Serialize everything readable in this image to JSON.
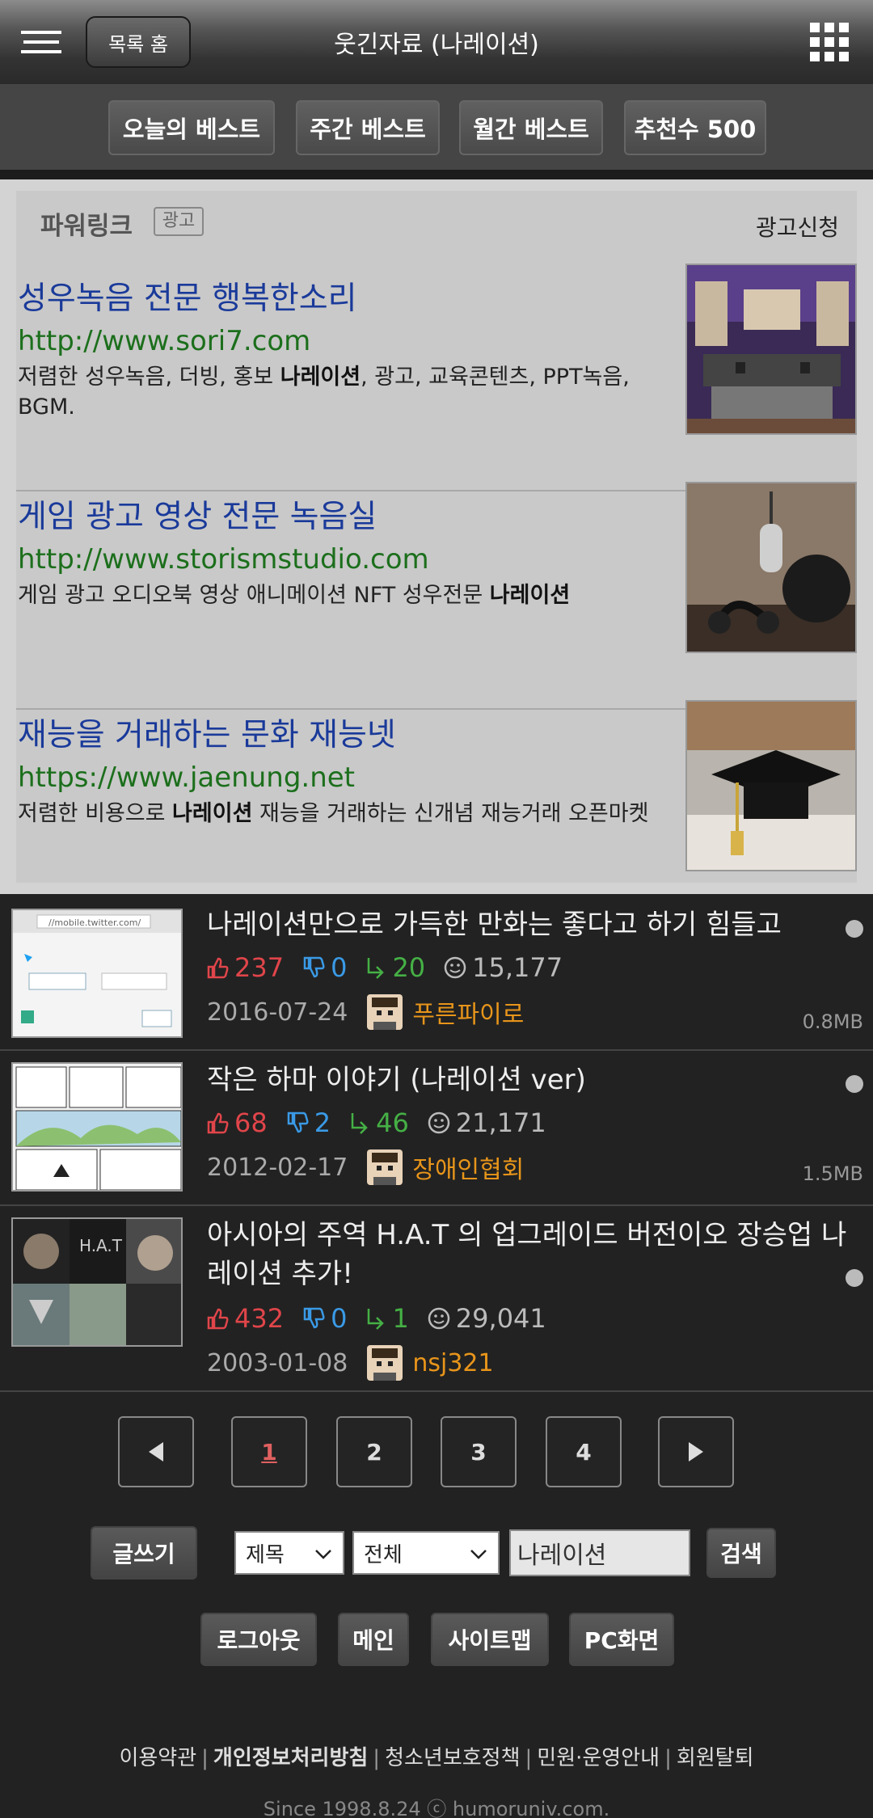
{
  "header": {
    "home_label": "목록 홈",
    "title": "웃긴자료 (나레이션)",
    "menu_icon": "menu-icon",
    "apps_icon": "grid-icon"
  },
  "tabs": [
    {
      "label": "오늘의 베스트"
    },
    {
      "label": "주간 베스트"
    },
    {
      "label": "월간 베스트"
    },
    {
      "label": "추천수 500"
    }
  ],
  "ads": {
    "logo": "파워링크",
    "badge": "광고",
    "apply": "광고신청",
    "items": [
      {
        "title": "성우녹음 전문 행복한소리",
        "url": "http://www.sori7.com",
        "desc_pre": "저렴한 성우녹음, 더빙, 홍보 ",
        "desc_bold": "나레이션",
        "desc_post": ", 광고, 교육콘텐츠, PPT녹음, BGM."
      },
      {
        "title": "게임 광고 영상 전문 녹음실",
        "url": "http://www.storismstudio.com",
        "desc_pre": "게임 광고 오디오북 영상 애니메이션 NFT 성우전문 ",
        "desc_bold": "나레이션",
        "desc_post": ""
      },
      {
        "title": "재능을 거래하는 문화 재능넷",
        "url": "https://www.jaenung.net",
        "desc_pre": "저렴한 비용으로 ",
        "desc_bold": "나레이션",
        "desc_post": " 재능을 거래하는 신개념 재능거래 오픈마켓"
      }
    ]
  },
  "posts": [
    {
      "title": "나레이션만으로 가득한 만화는 좋다고 하기 힘들고",
      "up": "237",
      "down": "0",
      "share": "20",
      "views": "15,177",
      "date": "2016-07-24",
      "author": "푸른파이로",
      "size": "0.8MB",
      "thumb_url": "//mobile.twitter.com/"
    },
    {
      "title": "작은 하마 이야기 (나레이션 ver)",
      "up": "68",
      "down": "2",
      "share": "46",
      "views": "21,171",
      "date": "2012-02-17",
      "author": "장애인협회",
      "size": "1.5MB"
    },
    {
      "title": "아시아의 주역 H.A.T 의 업그레이드 버전이오 장승업 나레이션 추가!",
      "up": "432",
      "down": "0",
      "share": "1",
      "views": "29,041",
      "date": "2003-01-08",
      "author": "nsj321",
      "size": ""
    }
  ],
  "pager": {
    "prev": "◀",
    "pages": [
      "1",
      "2",
      "3",
      "4"
    ],
    "next": "▶",
    "current": "1"
  },
  "search": {
    "write_label": "글쓰기",
    "field_select": "제목",
    "scope_select": "전체",
    "query": "나레이션",
    "search_label": "검색"
  },
  "bottom_buttons": [
    "로그아웃",
    "메인",
    "사이트맵",
    "PC화면"
  ],
  "footer": {
    "links": [
      "이용약관",
      "개인정보처리방침",
      "청소년보호정책",
      "민원·운영안내",
      "회원탈퇴"
    ],
    "copyright": "Since 1998.8.24 ⓒ humoruniv.com."
  },
  "colors": {
    "up": "#e0454a",
    "down": "#3a9ae6",
    "share": "#45b045",
    "author": "#e8951a",
    "ad_title": "#1a3a9a",
    "ad_url": "#1c6f1c"
  }
}
